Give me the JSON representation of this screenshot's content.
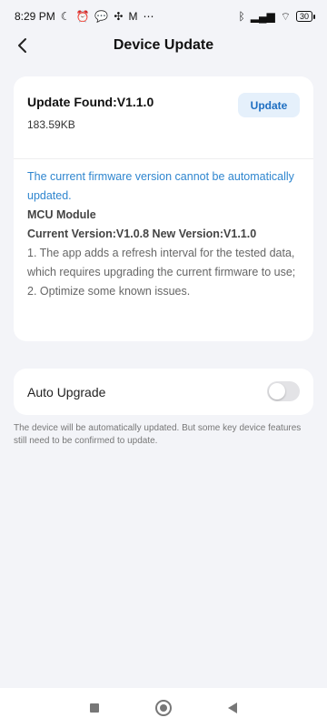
{
  "status_bar": {
    "time": "8:29 PM",
    "battery": "30",
    "icons": [
      "moon-icon",
      "alarm-off-icon",
      "chat-icon",
      "fan-icon",
      "gmail-icon",
      "more-dots-icon",
      "bluetooth-icon",
      "signal-icon",
      "wifi-icon"
    ]
  },
  "header": {
    "title": "Device Update",
    "back_icon": "chevron-left-icon"
  },
  "update_card": {
    "title": "Update Found:V1.1.0",
    "size": "183.59KB",
    "button_label": "Update",
    "notice": "The current firmware version cannot be automatically updated.",
    "module": "MCU Module",
    "versions": "Current Version:V1.0.8 New Version:V1.1.0",
    "changes": [
      "1. The app adds a refresh interval for the tested data, which requires upgrading the current firmware to use;",
      "2. Optimize some known issues."
    ]
  },
  "auto_upgrade": {
    "label": "Auto Upgrade",
    "enabled": false,
    "note": "The device will be automatically updated. But some key device features still need to be confirmed to update."
  },
  "colors": {
    "accent": "#2f86cf",
    "button_bg": "#e5f0fb",
    "page_bg": "#f3f4f8"
  }
}
